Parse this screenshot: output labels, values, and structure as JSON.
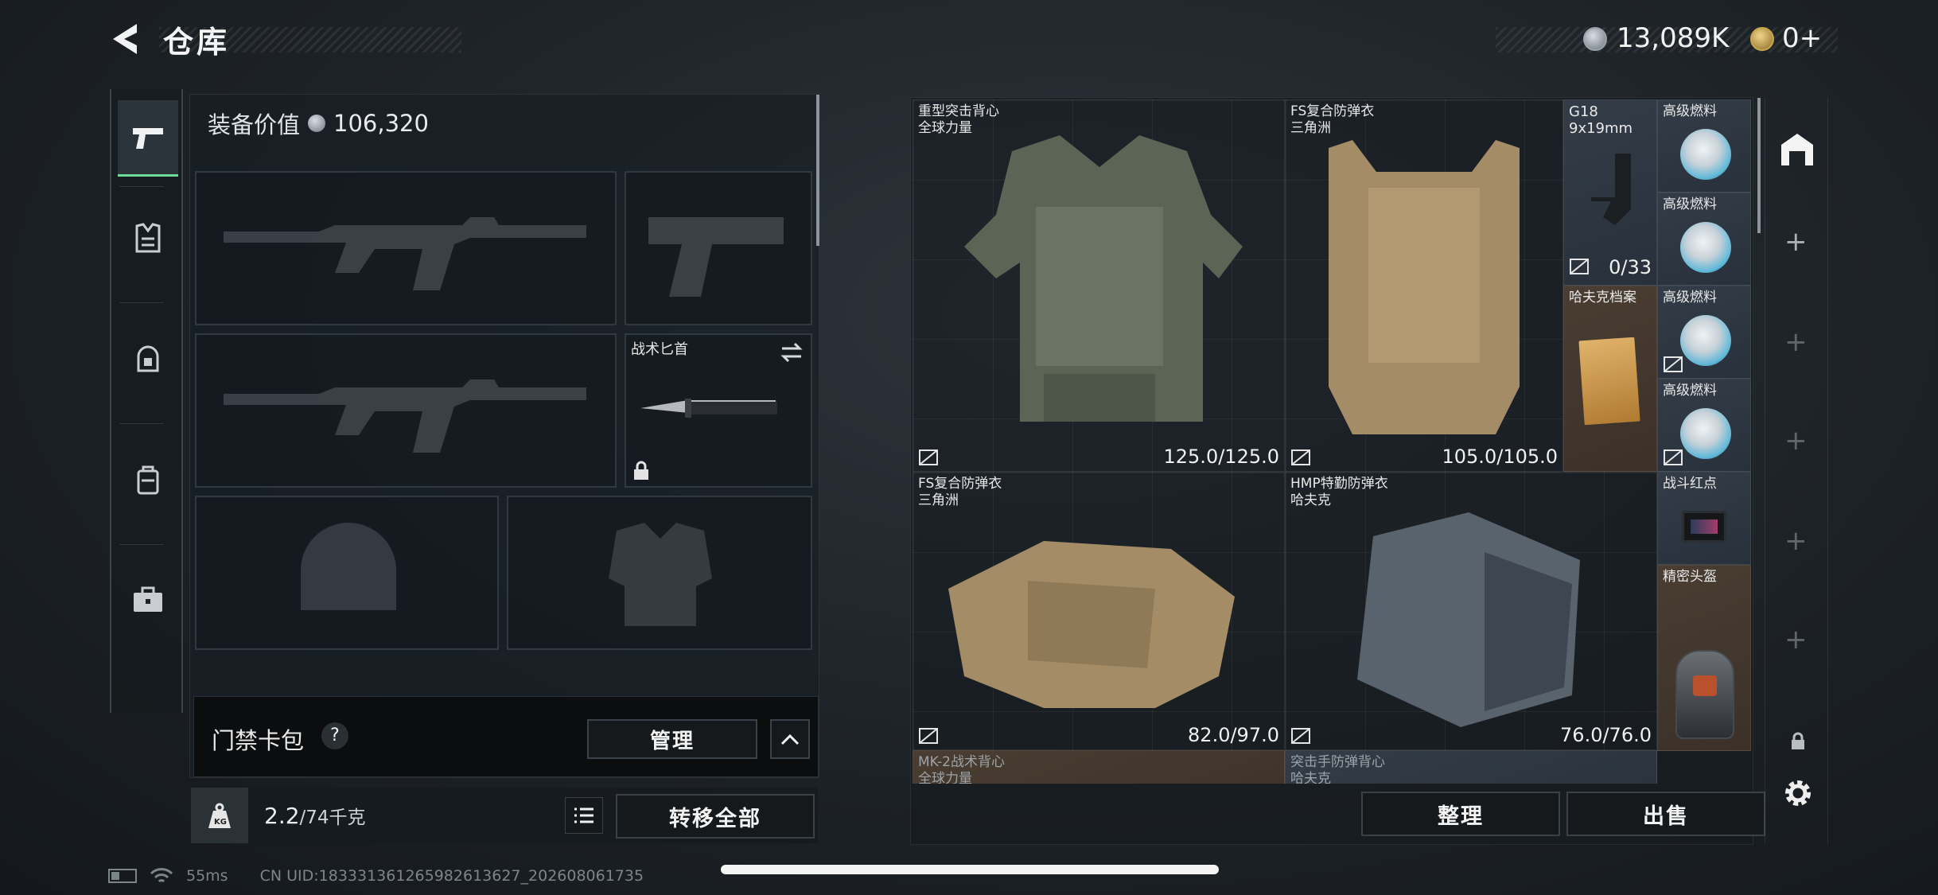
{
  "header": {
    "title": "仓库",
    "currency1": "13,089K",
    "currency2": "0+"
  },
  "left_tabs": [
    "weapon-tab-icon",
    "armor-tab-icon",
    "helmet-tab-icon",
    "backpack-tab-icon",
    "case-tab-icon"
  ],
  "loadout": {
    "value_label": "装备价值",
    "value": "106,320",
    "knife_name": "战术匕首"
  },
  "keycard": {
    "label": "门禁卡包",
    "help": "?",
    "manage": "管理"
  },
  "footer_left": {
    "weight_current": "2.2",
    "weight_max": "/74千克",
    "transfer_all": "转移全部"
  },
  "stash_items": [
    {
      "name": "重型突击背心\n全球力量",
      "durability": "125.0/125.0"
    },
    {
      "name": "FS复合防弹衣\n三角洲",
      "durability": "105.0/105.0"
    },
    {
      "name": "G18\n9x19mm",
      "ammo": "0/33"
    },
    {
      "name": "高级燃料"
    },
    {
      "name": "高级燃料"
    },
    {
      "name": "哈夫克档案"
    },
    {
      "name": "高级燃料"
    },
    {
      "name": "高级燃料"
    },
    {
      "name": "FS复合防弹衣\n三角洲",
      "durability": "82.0/97.0"
    },
    {
      "name": "HMP特勤防弹衣\n哈夫克",
      "durability": "76.0/76.0"
    },
    {
      "name": "战斗红点"
    },
    {
      "name": "精密头盔"
    },
    {
      "name": "MK-2战术背心\n全球力量"
    },
    {
      "name": "突击手防弹背心\n哈夫克"
    }
  ],
  "stash_buttons": {
    "sort": "整理",
    "sell": "出售"
  },
  "status_bar": {
    "ping": "55ms",
    "uid": "CN UID:1833313612659826136​27_20260806173​5"
  },
  "colors": {
    "accent_green": "#6ddc9a",
    "brown_cell": "#4a3d32",
    "blue_cell": "#333c47"
  }
}
